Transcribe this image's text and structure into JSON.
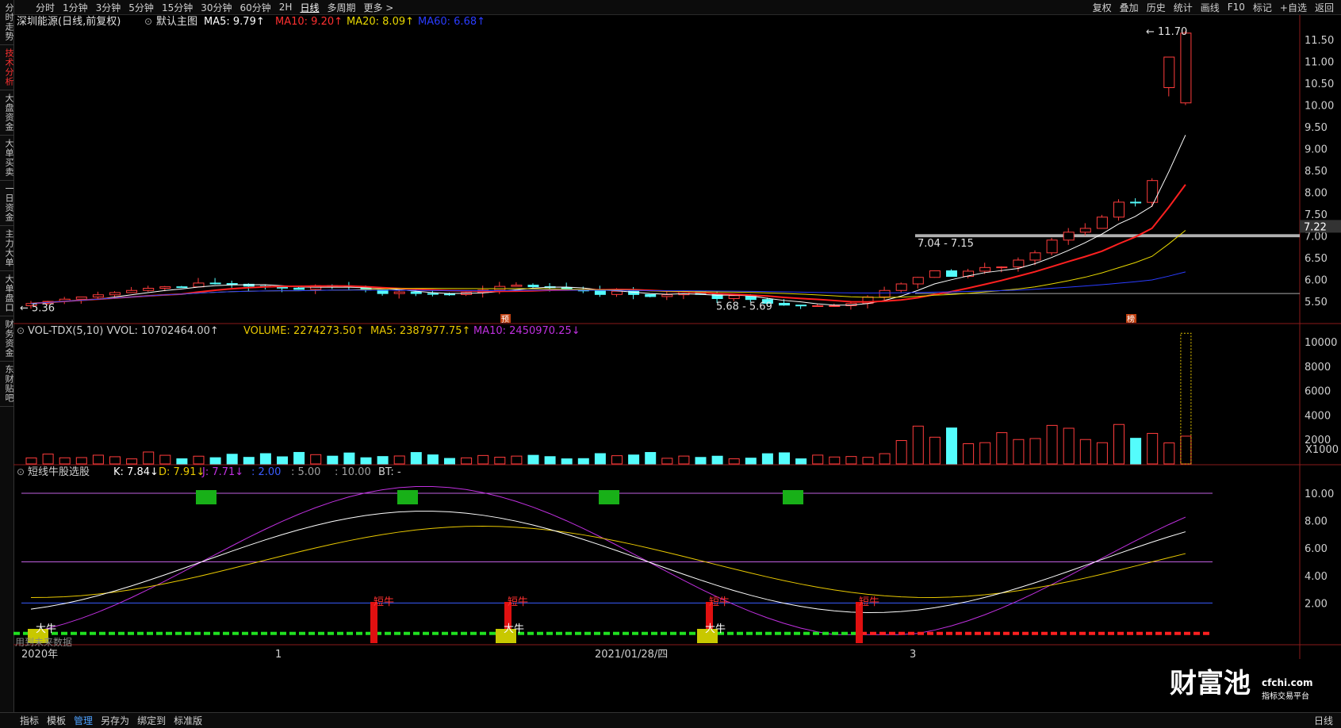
{
  "toolbar": {
    "periods": [
      "分时",
      "1分钟",
      "3分钟",
      "5分钟",
      "15分钟",
      "30分钟",
      "60分钟",
      "2H",
      "日线",
      "多周期",
      "更多 >"
    ],
    "active_period": "日线",
    "right": [
      "复权",
      "叠加",
      "历史",
      "统计",
      "画线",
      "F10",
      "标记",
      "+自选",
      "返回"
    ]
  },
  "left_tabs": [
    "分时走势",
    "技术分析",
    "大盘资金",
    "大单买卖",
    "一日资金",
    "主力大单",
    "大单盘口",
    "财务资金",
    "东财贴吧"
  ],
  "left_tabs_active": "技术分析",
  "main_chart": {
    "stock": "深圳能源(日线,前复权)",
    "template": "默认主图",
    "ma_labels": [
      {
        "text": "MA5: 9.79↑",
        "color": "#ffffff"
      },
      {
        "text": "MA10: 9.20↑",
        "color": "#ff3030"
      },
      {
        "text": "MA20: 8.09↑",
        "color": "#e8d800"
      },
      {
        "text": "MA60: 6.68↑",
        "color": "#2a3cff"
      }
    ],
    "price_axis": [
      "11.50",
      "11.00",
      "10.50",
      "10.00",
      "9.50",
      "9.00",
      "8.50",
      "8.00",
      "7.50",
      "7.00",
      "6.50",
      "6.00",
      "5.50"
    ],
    "current_price": "7.22",
    "annotations": {
      "high": "11.70",
      "low_left": "5.36",
      "low_mid": "5.68 - 5.69",
      "gap": "7.04 - 7.15"
    },
    "markers": [
      "预",
      "榜"
    ]
  },
  "volume_panel": {
    "labels": [
      {
        "text": "VOL-TDX(5,10) VVOL: 10702464.00↑",
        "color": "#d0d0d0"
      },
      {
        "text": "VOLUME: 2274273.50↑",
        "color": "#e8c800"
      },
      {
        "text": "MA5: 2387977.75↑",
        "color": "#e8c800"
      },
      {
        "text": "MA10: 2450970.25↓",
        "color": "#c030e0"
      }
    ],
    "axis": [
      "10000",
      "8000",
      "6000",
      "4000",
      "2000"
    ],
    "unit": "X1000"
  },
  "indicator_panel": {
    "labels": [
      {
        "text": "短线牛股选股",
        "color": "#d0d0d0"
      },
      {
        "text": "K: 7.84↓",
        "color": "#ffffff"
      },
      {
        "text": "D: 7.91↓",
        "color": "#e8c800"
      },
      {
        "text": "J: 7.71↓",
        "color": "#c030e0"
      },
      {
        "text": ": 2.00",
        "color": "#3a5cff"
      },
      {
        "text": ": 5.00",
        "color": "#a0a0a0"
      },
      {
        "text": ": 10.00",
        "color": "#a0a0a0"
      },
      {
        "text": "BT: -",
        "color": "#d0d0d0"
      }
    ],
    "axis": [
      "10.00",
      "8.00",
      "6.00",
      "4.00",
      "2.00"
    ],
    "signal_labels": {
      "short": "短牛",
      "long": "大牛"
    },
    "watermark_left": "用到未来数据"
  },
  "date_axis": {
    "year": "2020年",
    "ticks": [
      "1",
      "2021/01/28/四",
      "3"
    ]
  },
  "brand": {
    "name": "财富池",
    "url": "cfchi.com",
    "tagline": "指标交易平台"
  },
  "bottombar": {
    "items": [
      "指标",
      "模板",
      "管理",
      "另存为",
      "绑定到",
      "标准版"
    ],
    "active": "管理",
    "right": "日线"
  }
}
